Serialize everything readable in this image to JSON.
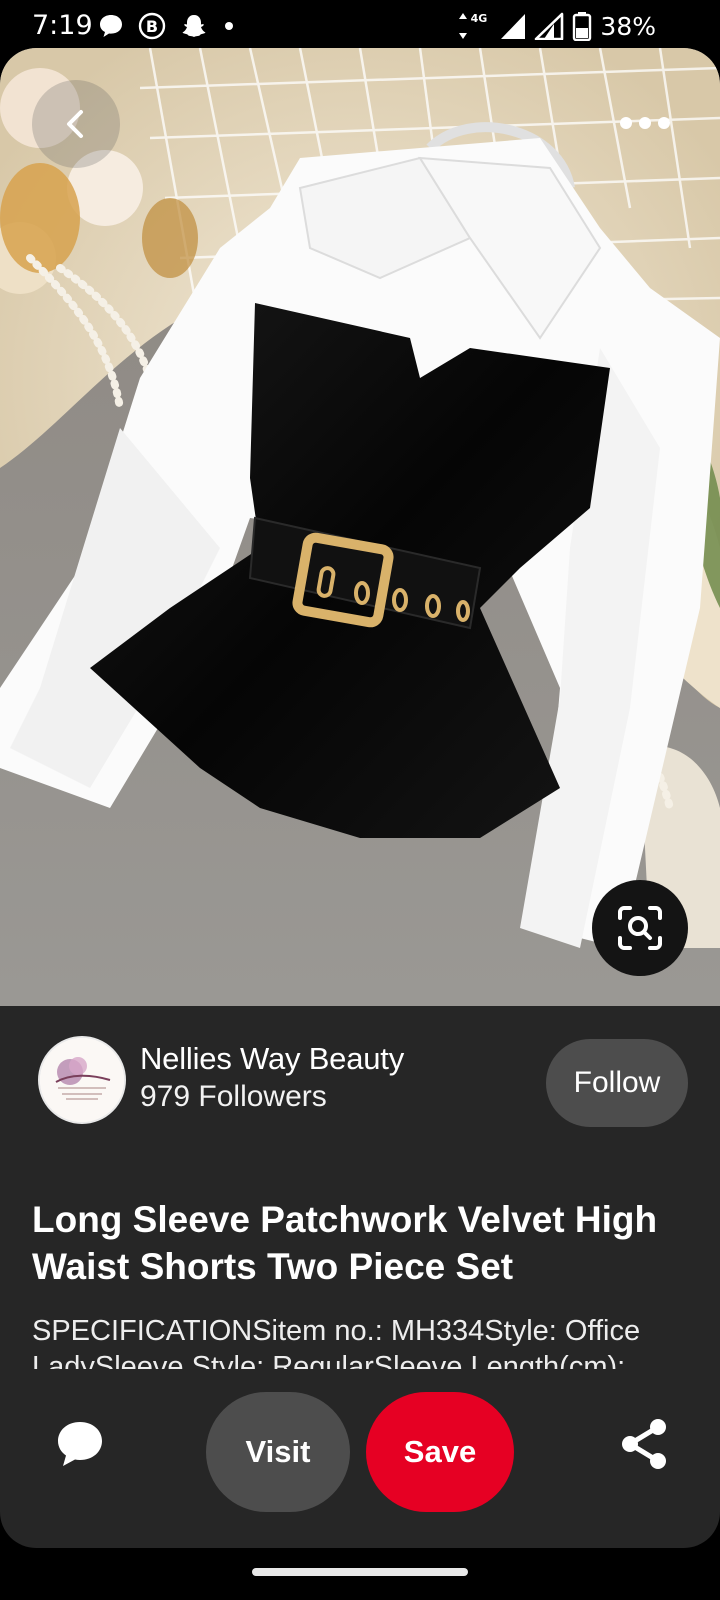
{
  "status_bar": {
    "time": "7:19",
    "battery": "38%",
    "left_icons": [
      "chat-bubble-icon",
      "b-circle-icon",
      "snapchat-ghost-icon",
      "dot-icon"
    ],
    "right_icons": [
      "data-arrows-icon",
      "signal-4g-icon",
      "signal-icon",
      "battery-icon"
    ],
    "network": "4G"
  },
  "navigation": {
    "back_icon": "chevron-left-icon",
    "more_icon": "more-horizontal-icon",
    "visual_search_icon": "visual-search-icon"
  },
  "creator": {
    "name": "Nellies Way Beauty",
    "followers": "979 Followers",
    "follow_label": "Follow"
  },
  "pin": {
    "title": "Long Sleeve Patchwork Velvet High Waist Shorts Two Piece Set",
    "description": "SPECIFICATIONSitem no.: MH334Style: Office LadySleeve Style: RegularSleeve Length(cm):"
  },
  "actions": {
    "comment_icon": "comment-icon",
    "visit_label": "Visit",
    "save_label": "Save",
    "share_icon": "share-icon"
  },
  "colors": {
    "background": "#262626",
    "save_red": "#e60023",
    "pill_gray": "#4d4d4d"
  }
}
